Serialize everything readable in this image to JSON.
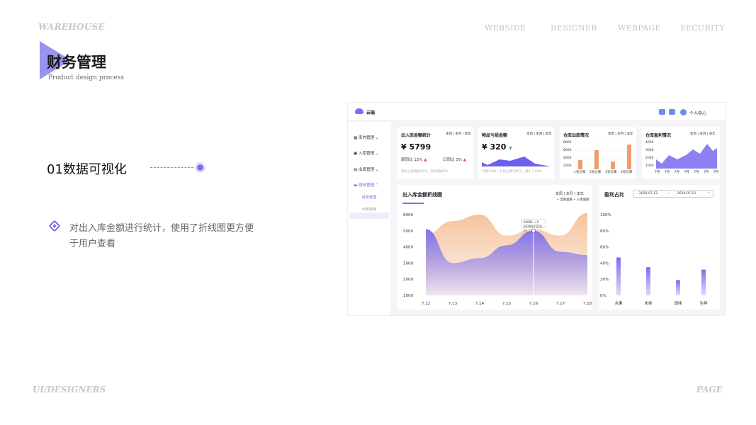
{
  "slide": {
    "brand": "WAREHOUSE",
    "nav": [
      "WEBSIDE",
      "DESIGNER",
      "WEBPAGE",
      "SECURITY"
    ],
    "title": "财务管理",
    "subtitle": "Product design process",
    "section_title": "01数据可视化",
    "description": "对出入库金额进行统计，使用了折线图更方便于用户查看",
    "footer_left": "UI/DESIGNERS",
    "footer_right": "PAGE"
  },
  "dashboard": {
    "app_name": "云端",
    "user_label": "个人中心",
    "sidebar": {
      "items": [
        "库内管理",
        "入库管理",
        "出库管理",
        "财务管理"
      ],
      "sub_items": [
        "财务管理",
        "出库费用"
      ]
    },
    "cards": [
      {
        "title": "出入库金额统计",
        "range": "本周 | 本月 | 本年",
        "value": "¥ 5799",
        "left_stat": "周同比 12%",
        "right_stat": "日同比 3%",
        "note": "同比上周增加12%，日同增加3%"
      },
      {
        "title": "物品亏损金额",
        "range": "本周 | 本月 | 本年",
        "value": "¥ 320",
        "note": "亏损320¥，对比上周亏损了，减少了10%"
      },
      {
        "title": "仓库出库情况",
        "range": "本周 | 本月 | 本年",
        "y_labels": [
          "8000",
          "6000",
          "4000",
          "2000",
          "1000"
        ],
        "x_labels": [
          "1号仓库",
          "2号仓库",
          "3号仓库",
          "4号仓库"
        ]
      },
      {
        "title": "仓库盈利情况",
        "range": "本周 | 本月 | 本年",
        "y_labels": [
          "4000",
          "3000",
          "2000",
          "1000"
        ],
        "x_labels": [
          "7月",
          "7月",
          "7月",
          "7月",
          "7月",
          "7月",
          "7月"
        ]
      }
    ],
    "line_panel": {
      "title": "出入库金额折线图",
      "range": "本周 | 本月 | 本年",
      "legend": [
        "出库金额",
        "入库金额"
      ],
      "tooltip": [
        "¥5000 → ¥",
        "2020年7月16日"
      ]
    },
    "profit_panel": {
      "title": "盈利占比",
      "date_from": "2020-07-12",
      "date_to": "2020-07-12",
      "arrow": "→"
    }
  },
  "chart_data": [
    {
      "type": "area",
      "title": "出入库金额折线图",
      "x": [
        "7.12",
        "7.13",
        "7.14",
        "7.15",
        "7.16",
        "7.17",
        "7.18"
      ],
      "ylim": [
        1000,
        6000
      ],
      "yticks": [
        6000,
        5000,
        4000,
        3000,
        2000,
        1000
      ],
      "series": [
        {
          "name": "出库金额",
          "values": [
            4800,
            5600,
            6000,
            4700,
            5100,
            4700,
            6100
          ]
        },
        {
          "name": "入库金额",
          "values": [
            5100,
            3000,
            3300,
            4100,
            5000,
            3700,
            3500
          ]
        }
      ],
      "colors": [
        "#f3b88a",
        "#7b6ff0"
      ]
    },
    {
      "type": "bar",
      "title": "盈利占比",
      "categories": [
        "水果",
        "肉类",
        "调味",
        "生鲜"
      ],
      "values": [
        47,
        35,
        19,
        32
      ],
      "yticks": [
        "100%",
        "80%",
        "60%",
        "40%",
        "20%",
        "0%"
      ],
      "ylim": [
        0,
        100
      ],
      "color": "#7b6ff0"
    },
    {
      "type": "bar",
      "title": "仓库出库情况",
      "categories": [
        "1号仓库",
        "2号仓库",
        "3号仓库",
        "4号仓库"
      ],
      "values": [
        3400,
        6000,
        3000,
        7400
      ],
      "ylim": [
        1000,
        8000
      ],
      "color": "#ef9d6a"
    }
  ],
  "colors": {
    "accent": "#7b6ff0",
    "orange": "#f3b88a",
    "up": "#e04b3c",
    "down": "#3cbc5a"
  }
}
